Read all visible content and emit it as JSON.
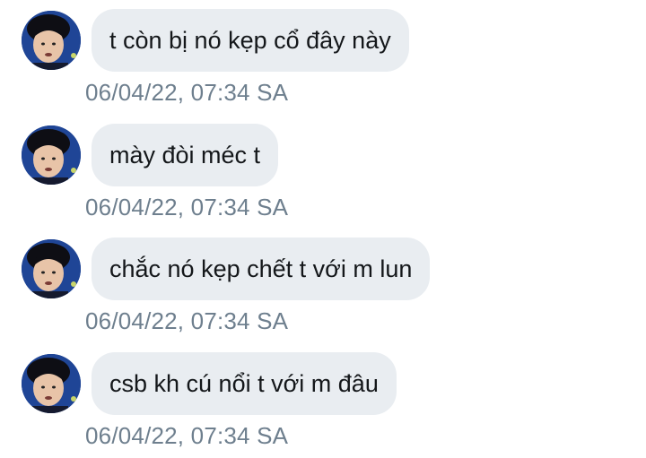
{
  "messages": [
    {
      "text": "t còn bị nó kẹp cổ đây này",
      "time": "06/04/22, 07:34 SA"
    },
    {
      "text": "mày đòi méc t",
      "time": "06/04/22, 07:34 SA"
    },
    {
      "text": "chắc nó kẹp chết t với m lun",
      "time": "06/04/22, 07:34 SA"
    },
    {
      "text": "csb kh cú nổi t với m đâu",
      "time": "06/04/22, 07:34 SA"
    }
  ],
  "colors": {
    "bubble": "#e9edf1",
    "text": "#14171a",
    "timestamp": "#6e7f8e",
    "avatar_bg": "#1d3f8e"
  },
  "icons": {
    "avatar": "user-avatar-photo"
  }
}
